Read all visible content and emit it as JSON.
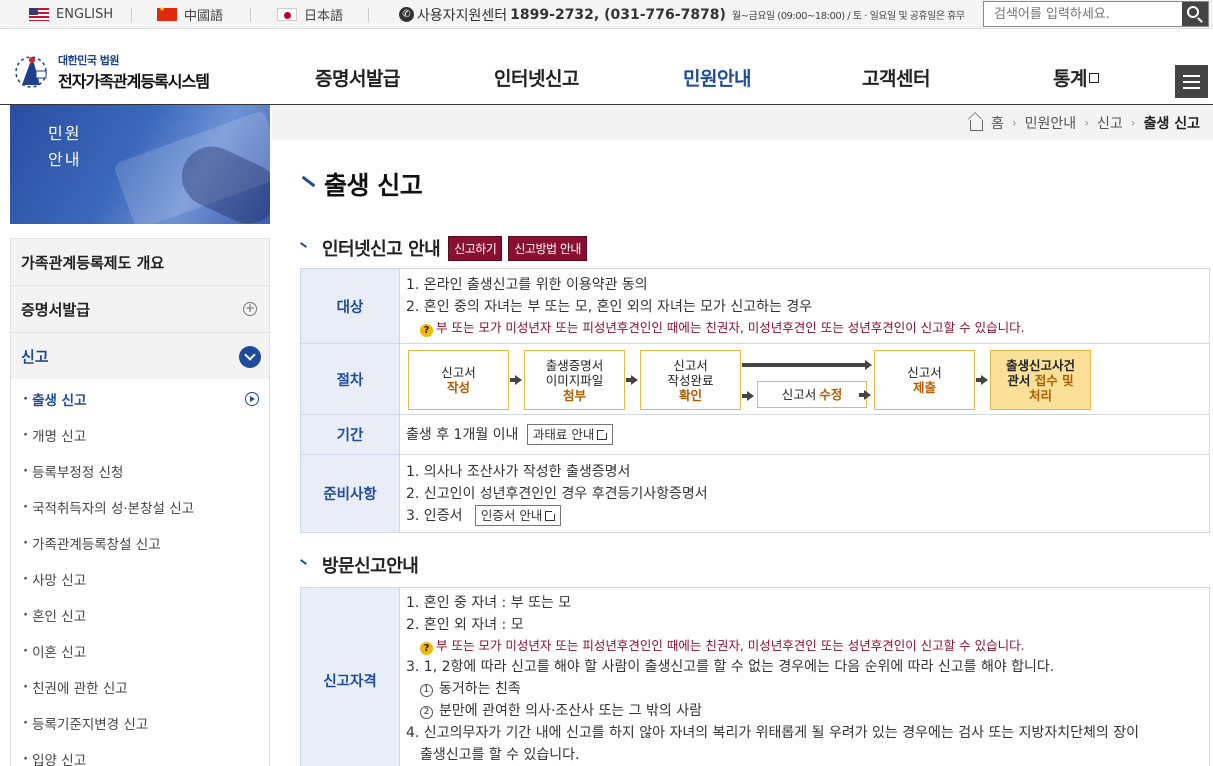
{
  "topbar": {
    "languages": [
      "ENGLISH",
      "中國語",
      "日本語"
    ],
    "support_label": "사용자지원센터",
    "support_numbers": "1899-2732, (031-776-7878)",
    "support_hours": "월~금요일 (09:00~18:00) / 토 · 일요일 및 공휴일은 휴무",
    "search_placeholder": "검색어를 입력하세요."
  },
  "header": {
    "logo_line1": "대한민국 법원",
    "logo_line2": "전자가족관계등록시스템",
    "nav": [
      "증명서발급",
      "인터넷신고",
      "민원안내",
      "고객센터",
      "통계"
    ],
    "active_nav": "민원안내"
  },
  "side_banner": {
    "line1": "민원",
    "line2": "안내"
  },
  "lnb": {
    "items": [
      {
        "label": "가족관계등록제도 개요"
      },
      {
        "label": "증명서발급"
      },
      {
        "label": "신고"
      }
    ],
    "sub_items": [
      "출생 신고",
      "개명 신고",
      "등록부정정 신청",
      "국적취득자의 성·본창설 신고",
      "가족관계등록창설 신고",
      "사망 신고",
      "혼인 신고",
      "이혼 신고",
      "친권에 관한 신고",
      "등록기준지변경 신고",
      "입양 신고"
    ]
  },
  "breadcrumb": [
    "홈",
    "민원안내",
    "신고",
    "출생 신고"
  ],
  "page_title": "출생 신고",
  "internet": {
    "title": "인터넷신고 안내",
    "tag1": "신고하기",
    "tag2": "신고방법 안내",
    "target_label": "대상",
    "target_lines": [
      "1. 온라인 출생신고를 위한 이용약관 동의",
      "2. 혼인 중의 자녀는 부 또는 모, 혼인 외의 자녀는 모가 신고하는 경우"
    ],
    "target_note": "부 또는 모가 미성년자 또는 피성년후견인인 때에는 친권자, 미성년후견인 또는 성년후견인이 신고할 수 있습니다.",
    "procedure_label": "절차",
    "flow": {
      "s1a": "신고서",
      "s1b": "작성",
      "s2a": "출생증명서",
      "s2b": "이미지파일",
      "s2c": "첨부",
      "s3a": "신고서",
      "s3b": "작성완료",
      "s3c": "확인",
      "s4a": "신고서",
      "s4b": "수정",
      "s5a": "신고서",
      "s5b": "제출",
      "s6a": "출생신고사건",
      "s6b": "관서",
      "s6c": "접수 및",
      "s6d": "처리"
    },
    "period_label": "기간",
    "period_text": "출생 후 1개월 이내",
    "period_btn": "과태료 안내",
    "prep_label": "준비사항",
    "prep_lines": [
      "1. 의사나 조산사가 작성한 출생증명서",
      "2. 신고인이 성년후견인인 경우 후견등기사항증명서",
      "3. 인증서"
    ],
    "prep_btn": "인증서 안내"
  },
  "visit": {
    "title": "방문신고안내",
    "qual_label": "신고자격",
    "line1": "1. 혼인 중 자녀 : 부 또는 모",
    "line2": "2. 혼인 외 자녀 : 모",
    "note": "부 또는 모가 미성년자 또는 피성년후견인인 때에는 친권자, 미성년후견인 또는 성년후견인이 신고할 수 있습니다.",
    "line3": "3. 1, 2항에 따라 신고를 해야 할 사람이 출생신고를 할 수 없는 경우에는 다음 순위에 따라 신고를 해야 합니다.",
    "sub1": "동거하는 친족",
    "sub2": "분만에 관여한 의사·조산사 또는 그 밖의 사람",
    "line4a": "4. 신고의무자가 기간 내에 신고를 하지 않아 자녀의 복리가 위태롭게 될 우려가 있는 경우에는 검사 또는 지방자치단체의 장이",
    "line4b": "출생신고를 할 수 있습니다."
  }
}
